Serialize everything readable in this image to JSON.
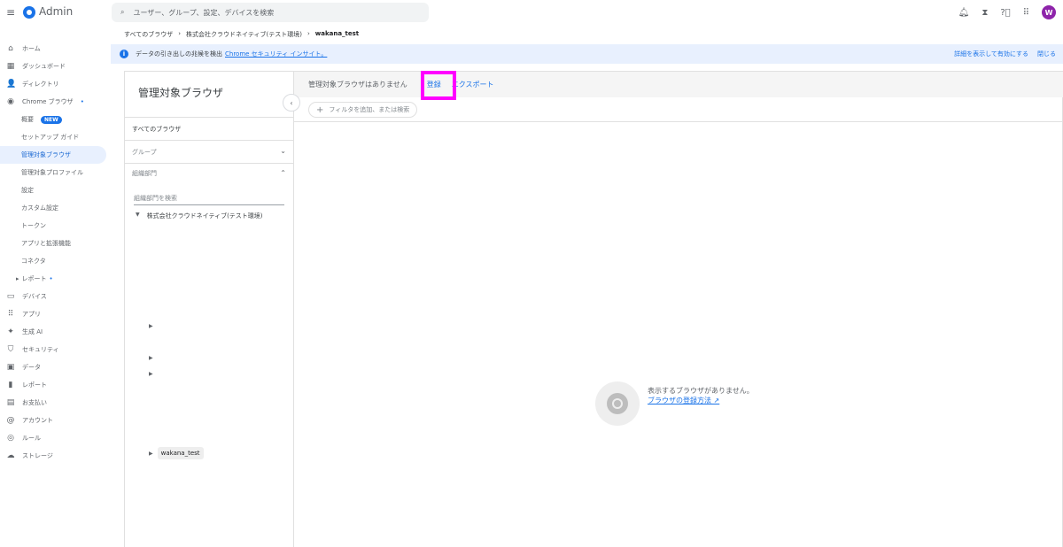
{
  "app": {
    "title": "Admin",
    "search_placeholder": "ユーザー、グループ、設定、デバイスを検索",
    "avatar": "W"
  },
  "sidebar": {
    "items": [
      {
        "label": "ホーム",
        "icon": "⌂"
      },
      {
        "label": "ダッシュボード",
        "icon": "▦"
      },
      {
        "label": "ディレクトリ",
        "icon": "👤"
      },
      {
        "label": "Chrome ブラウザ",
        "icon": "◉"
      },
      {
        "label": "概要",
        "badge": "NEW"
      },
      {
        "label": "セットアップ ガイド"
      },
      {
        "label": "管理対象ブラウザ"
      },
      {
        "label": "管理対象プロファイル"
      },
      {
        "label": "設定"
      },
      {
        "label": "カスタム設定"
      },
      {
        "label": "トークン"
      },
      {
        "label": "アプリと拡張機能"
      },
      {
        "label": "コネクタ"
      },
      {
        "label": "レポート"
      },
      {
        "label": "デバイス",
        "icon": "▭"
      },
      {
        "label": "アプリ",
        "icon": "⠿"
      },
      {
        "label": "生成 AI",
        "icon": "✦"
      },
      {
        "label": "セキュリティ",
        "icon": "⛉"
      },
      {
        "label": "データ",
        "icon": "▣"
      },
      {
        "label": "レポート",
        "icon": "▮"
      },
      {
        "label": "お支払い",
        "icon": "▤"
      },
      {
        "label": "アカウント",
        "icon": "@"
      },
      {
        "label": "ルール",
        "icon": "◎"
      },
      {
        "label": "ストレージ",
        "icon": "☁"
      }
    ]
  },
  "breadcrumb": [
    "すべてのブラウザ",
    "株式会社クラウドネイティブ(テスト環境)",
    "wakana_test"
  ],
  "banner": {
    "text": "データの引き出しの兆候を検出",
    "link": "Chrome セキュリティ インサイト。",
    "details": "詳細を表示して有効にする",
    "close": "閉じる"
  },
  "left_panel": {
    "title": "管理対象ブラウザ",
    "all": "すべてのブラウザ",
    "groups": "グループ",
    "org": "組織部門",
    "org_search_placeholder": "組織部門を検索",
    "tree_root": "株式会社クラウドネイティブ(テスト環境)",
    "selected_node": "wakana_test"
  },
  "right_panel": {
    "status": "管理対象ブラウザはありません",
    "register": "登録",
    "export": "エクスポート",
    "filter_placeholder": "フィルタを追加、または検索",
    "empty_text": "表示するブラウザがありません。",
    "empty_link": "ブラウザの登録方法"
  }
}
